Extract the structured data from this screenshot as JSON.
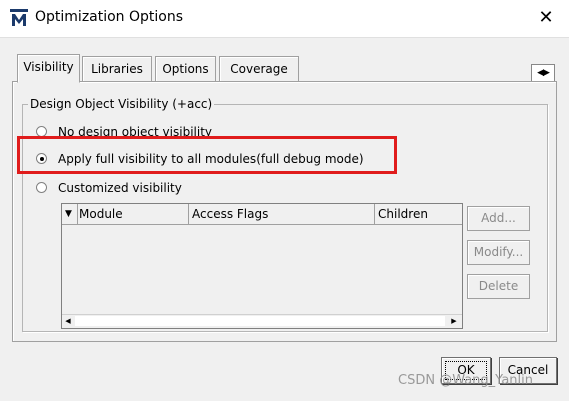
{
  "window": {
    "title": "Optimization Options",
    "close_glyph": "✕"
  },
  "tabs": [
    {
      "label": "Visibility",
      "active": true
    },
    {
      "label": "Libraries",
      "active": false
    },
    {
      "label": "Options",
      "active": false
    },
    {
      "label": "Coverage",
      "active": false
    }
  ],
  "tab_scroll": {
    "left": "◀",
    "right": "▶"
  },
  "groupbox": {
    "legend": "Design Object Visibility (+acc)",
    "options": [
      {
        "label": "No design object visibility",
        "checked": false
      },
      {
        "label": "Apply full visibility to all modules(full debug mode)",
        "checked": true
      },
      {
        "label": "Customized visibility",
        "checked": false
      }
    ]
  },
  "table": {
    "sort_indicator": "▼",
    "columns": [
      "Module",
      "Access Flags",
      "Children"
    ],
    "rows": []
  },
  "side_buttons": {
    "add": "Add...",
    "modify": "Modify...",
    "delete": "Delete"
  },
  "footer": {
    "ok": "OK",
    "cancel": "Cancel"
  },
  "watermark": "CSDN @Wang_Yanlin",
  "colors": {
    "highlight_border": "#e01c1c",
    "disabled_text": "#8a8a8a"
  },
  "icons": {
    "app": "app-logo-icon",
    "close": "close-icon"
  }
}
